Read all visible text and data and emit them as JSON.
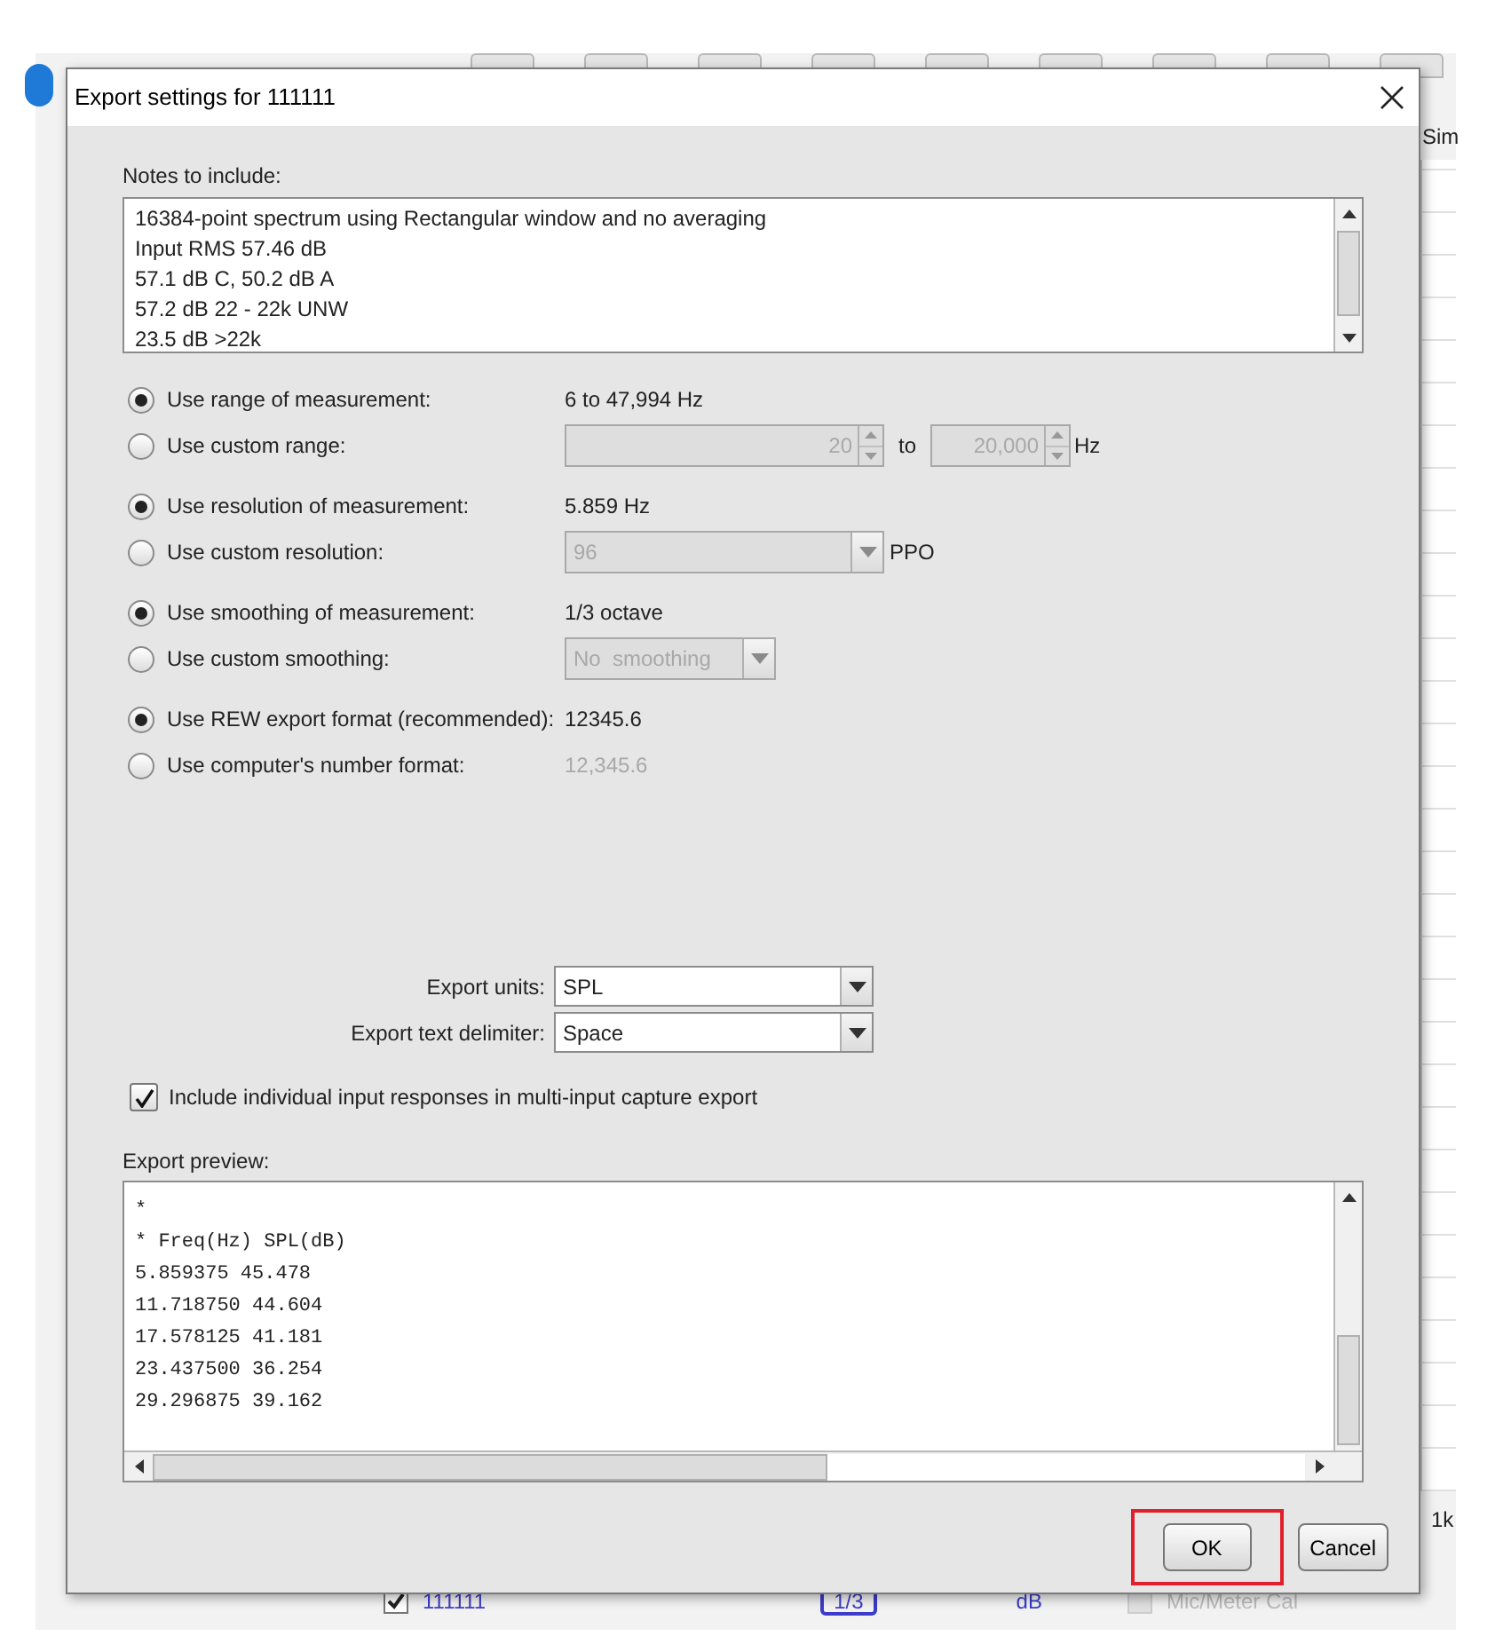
{
  "background": {
    "toolbar_label": "Sim",
    "axis_label": "1k",
    "trace": {
      "name": "111111",
      "checked": true,
      "smoothing": "1/3",
      "unit": "dB"
    },
    "cal": {
      "label": "Mic/Meter Cal",
      "checked": false
    }
  },
  "dialog": {
    "title": "Export settings for 111111",
    "notes": {
      "label": "Notes to include:",
      "lines": [
        "16384-point spectrum using Rectangular window and no averaging",
        "Input RMS 57.46 dB",
        "57.1 dB C, 50.2 dB A",
        "57.2 dB 22 - 22k UNW",
        "23.5 dB >22k"
      ]
    },
    "option_groups": [
      [
        {
          "label": "Use range of measurement:",
          "selected": true,
          "kind": "text",
          "value": "6 to 47,994 Hz",
          "disabled": false
        },
        {
          "label": "Use custom range:",
          "selected": false,
          "kind": "range",
          "from": "20",
          "to_label": "to",
          "to": "20,000",
          "unit": "Hz"
        }
      ],
      [
        {
          "label": "Use resolution of measurement:",
          "selected": true,
          "kind": "text",
          "value": "5.859 Hz",
          "disabled": false
        },
        {
          "label": "Use custom resolution:",
          "selected": false,
          "kind": "select",
          "value": "96",
          "unit": "PPO"
        }
      ],
      [
        {
          "label": "Use smoothing of measurement:",
          "selected": true,
          "kind": "text",
          "value": "1/3 octave",
          "disabled": false
        },
        {
          "label": "Use custom smoothing:",
          "selected": false,
          "kind": "select",
          "value": "No  smoothing"
        }
      ],
      [
        {
          "label": "Use REW export format (recommended):",
          "selected": true,
          "kind": "text",
          "value": "12345.6",
          "disabled": false
        },
        {
          "label": "Use computer's number format:",
          "selected": false,
          "kind": "text",
          "value": "12,345.6",
          "disabled": true
        }
      ]
    ],
    "export_fields": [
      {
        "label": "Export units:",
        "value": "SPL"
      },
      {
        "label": "Export text delimiter:",
        "value": "Space"
      }
    ],
    "include_checkbox": {
      "label": "Include individual input responses in multi-input capture export",
      "checked": true
    },
    "preview": {
      "label": "Export preview:",
      "lines": [
        "*",
        "* Freq(Hz) SPL(dB)",
        "5.859375 45.478",
        "11.718750 44.604",
        "17.578125 41.181",
        "23.437500 36.254",
        "29.296875 39.162"
      ]
    },
    "buttons": [
      {
        "label": "OK",
        "annotated": true
      },
      {
        "label": "Cancel",
        "annotated": false
      }
    ]
  }
}
